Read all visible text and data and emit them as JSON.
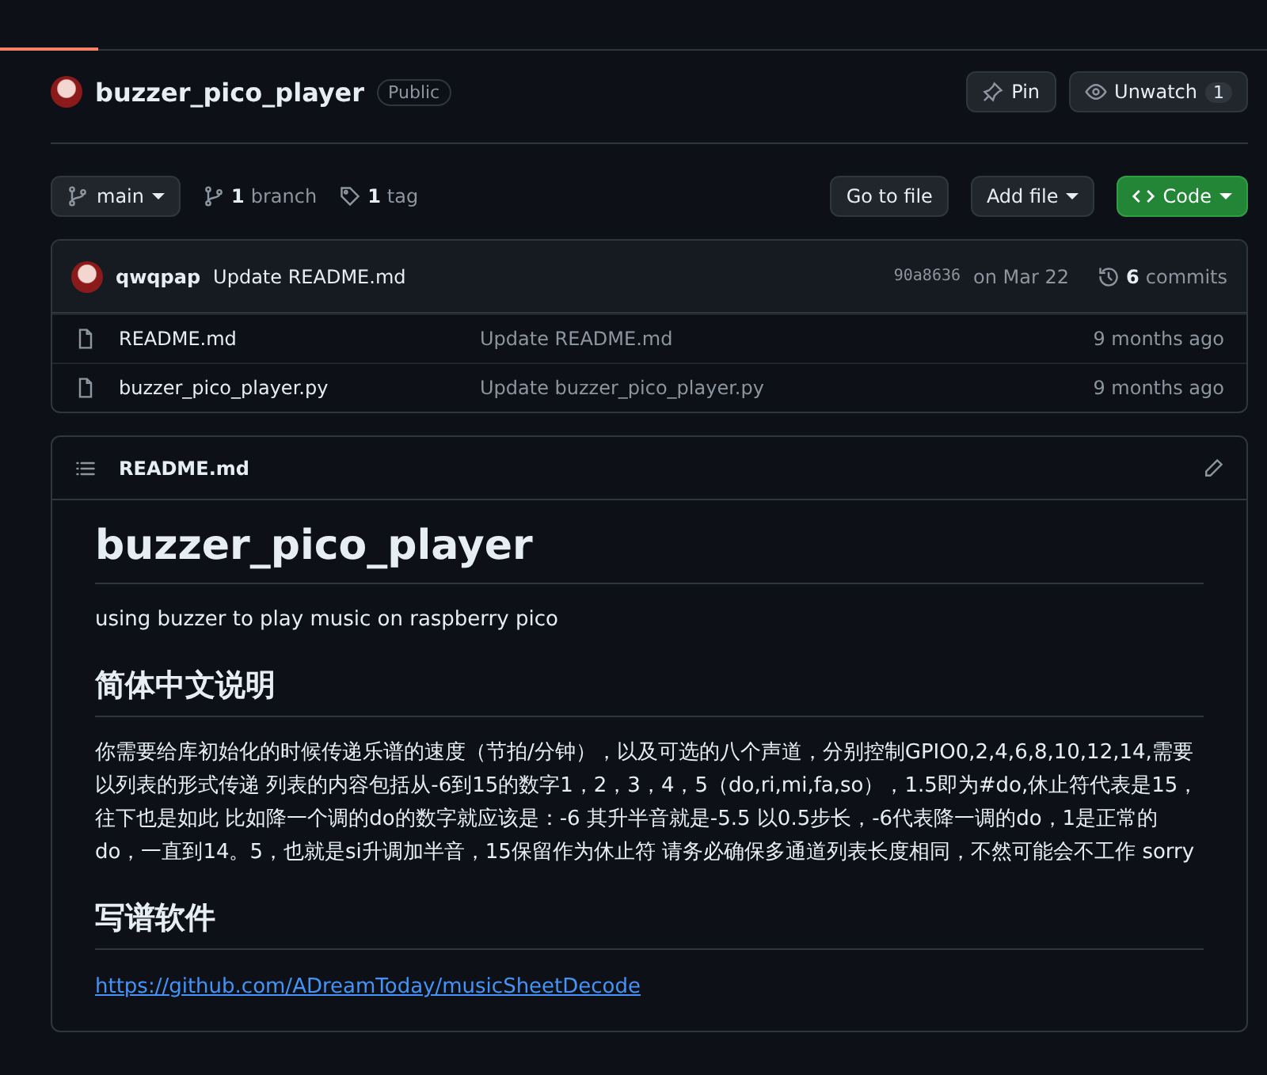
{
  "repo": {
    "name": "buzzer_pico_player",
    "visibility": "Public",
    "pin": "Pin",
    "watch": "Unwatch",
    "watch_count": "1"
  },
  "toolbar": {
    "branch": "main",
    "branches_count": "1",
    "branches_label": "branch",
    "tags_count": "1",
    "tags_label": "tag",
    "go_to_file": "Go to file",
    "add_file": "Add file",
    "code": "Code"
  },
  "commit": {
    "author": "qwqpap",
    "message": "Update README.md",
    "hash": "90a8636",
    "date": "on Mar 22",
    "commits_count": "6",
    "commits_label": "commits"
  },
  "files": [
    {
      "name": "README.md",
      "message": "Update README.md",
      "age": "9 months ago"
    },
    {
      "name": "buzzer_pico_player.py",
      "message": "Update buzzer_pico_player.py",
      "age": "9 months ago"
    }
  ],
  "readme": {
    "file": "README.md",
    "title": "buzzer_pico_player",
    "intro": "using buzzer to play music on raspberry pico",
    "h2_1": "简体中文说明",
    "body": "你需要给库初始化的时候传递乐谱的速度（节拍/分钟），以及可选的八个声道，分别控制GPIO0,2,4,6,8,10,12,14,需要以列表的形式传递 列表的内容包括从-6到15的数字1，2，3，4，5（do,ri,mi,fa,so），1.5即为#do,休止符代表是15，往下也是如此 比如降一个调的do的数字就应该是：-6 其升半音就是-5.5 以0.5步长，-6代表降一调的do，1是正常的do，一直到14。5，也就是si升调加半音，15保留作为休止符 请务必确保多通道列表长度相同，不然可能会不工作 sorry",
    "h2_2": "写谱软件",
    "link": "https://github.com/ADreamToday/musicSheetDecode"
  }
}
